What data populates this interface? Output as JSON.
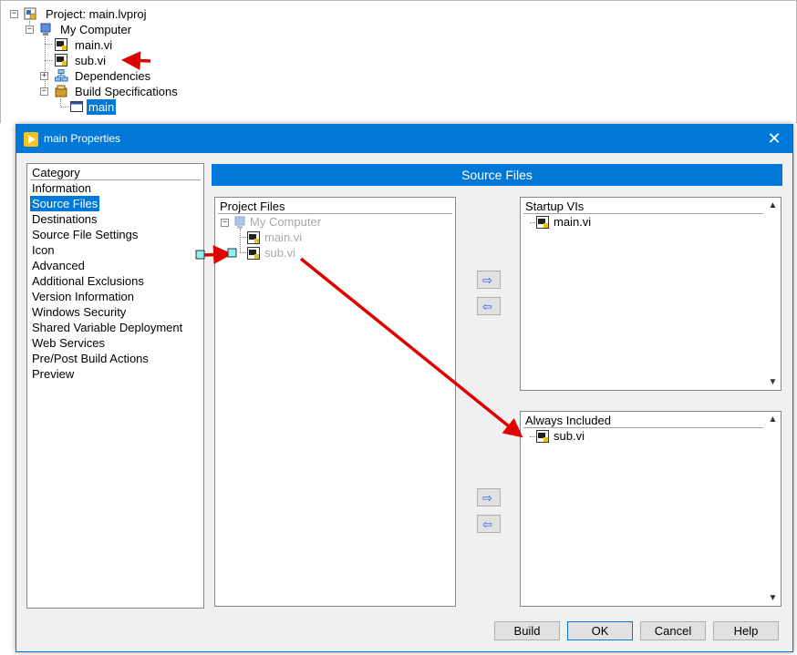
{
  "project_tree": {
    "root": "Project: main.lvproj",
    "computer": "My Computer",
    "items": [
      "main.vi",
      "sub.vi",
      "Dependencies",
      "Build Specifications"
    ],
    "build_item": "main"
  },
  "dialog": {
    "title": "main Properties",
    "close_glyph": "✕",
    "category_header": "Category",
    "categories": [
      "Information",
      "Source Files",
      "Destinations",
      "Source File Settings",
      "Icon",
      "Advanced",
      "Additional Exclusions",
      "Version Information",
      "Windows Security",
      "Shared Variable Deployment",
      "Web Services",
      "Pre/Post Build Actions",
      "Preview"
    ],
    "selected_category": "Source Files",
    "banner": "Source Files",
    "project_files": {
      "header": "Project Files",
      "computer": "My Computer",
      "items": [
        "main.vi",
        "sub.vi"
      ]
    },
    "startup": {
      "header": "Startup VIs",
      "items": [
        "main.vi"
      ]
    },
    "always_included": {
      "header": "Always Included",
      "items": [
        "sub.vi"
      ]
    },
    "arrows": {
      "add": "⇨",
      "remove": "⇦"
    },
    "buttons": {
      "build": "Build",
      "ok": "OK",
      "cancel": "Cancel",
      "help": "Help"
    }
  },
  "colors": {
    "accent": "#0078d7",
    "annotation_red": "#e00000",
    "disabled_text": "#a8a8a8"
  }
}
